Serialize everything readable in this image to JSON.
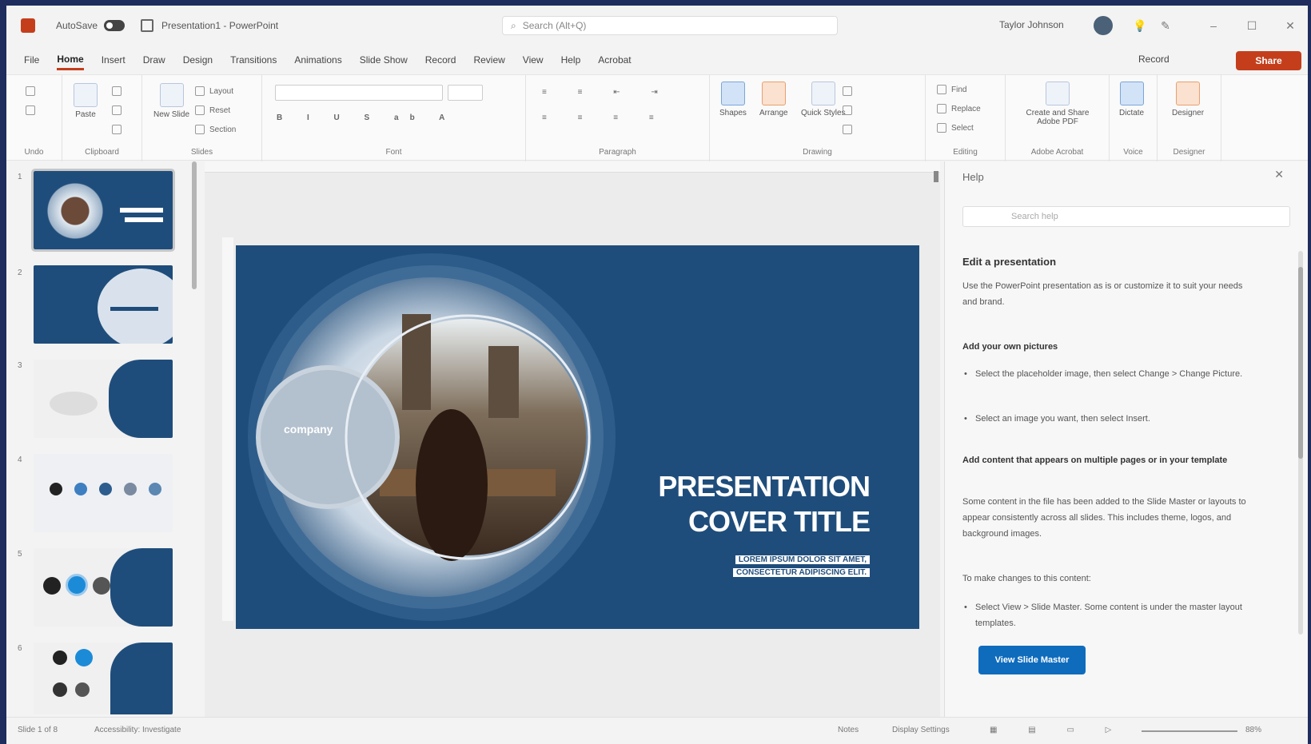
{
  "titlebar": {
    "autosave": "AutoSave",
    "filename": "Presentation1 - PowerPoint",
    "search_placeholder": "Search (Alt+Q)",
    "user": "Taylor Johnson"
  },
  "tabs": [
    "File",
    "Home",
    "Insert",
    "Draw",
    "Design",
    "Transitions",
    "Animations",
    "Slide Show",
    "Record",
    "Review",
    "View",
    "Help",
    "Acrobat"
  ],
  "active_tab": "Home",
  "record_label": "Record",
  "share_label": "Share",
  "ribbon": {
    "groups": [
      "Undo",
      "Clipboard",
      "Slides",
      "Font",
      "Paragraph",
      "Drawing",
      "Editing",
      "Adobe Acrobat",
      "Voice",
      "Designer"
    ],
    "paste": "Paste",
    "new_slide": "New Slide",
    "layout": "Layout",
    "reset": "Reset",
    "section": "Section",
    "shapes": "Shapes",
    "arrange": "Arrange",
    "quick_styles": "Quick Styles",
    "find": "Find",
    "replace": "Replace",
    "select": "Select",
    "create_pdf": "Create and Share Adobe PDF",
    "dictate": "Dictate",
    "designer": "Designer"
  },
  "slide": {
    "logo": "company",
    "title_line1": "PRESENTATION",
    "title_line2": "COVER TITLE",
    "sub_line1": "LOREM IPSUM DOLOR SIT AMET,",
    "sub_line2": "CONSECTETUR ADIPISCING ELIT."
  },
  "thumbnails": [
    "1",
    "2",
    "3",
    "4",
    "5",
    "6"
  ],
  "help": {
    "title": "Help",
    "search_placeholder": "Search help",
    "heading": "Edit a presentation",
    "intro": "Use the PowerPoint presentation as is or customize it to suit your needs and brand.",
    "sub1": "Add your own pictures",
    "bullet1": "Select the placeholder image, then select Change > Change Picture.",
    "bullet2": "Select an image you want, then select Insert.",
    "sub2": "Add content that appears on multiple pages or in your template",
    "para2": "Some content in the file has been added to the Slide Master or layouts to appear consistently across all slides. This includes theme, logos, and background images.",
    "para3": "To make changes to this content:",
    "bullet3": "Select View > Slide Master. Some content is under the master layout templates.",
    "button": "View Slide Master"
  },
  "status": {
    "slide": "Slide 1 of 8",
    "accessibility": "Accessibility: Investigate",
    "notes": "Notes",
    "display": "Display Settings",
    "zoom": "88%"
  },
  "colors": {
    "accent": "#c43e1c",
    "slide_bg": "#1f4d7b",
    "help_button": "#0f6cbd"
  }
}
